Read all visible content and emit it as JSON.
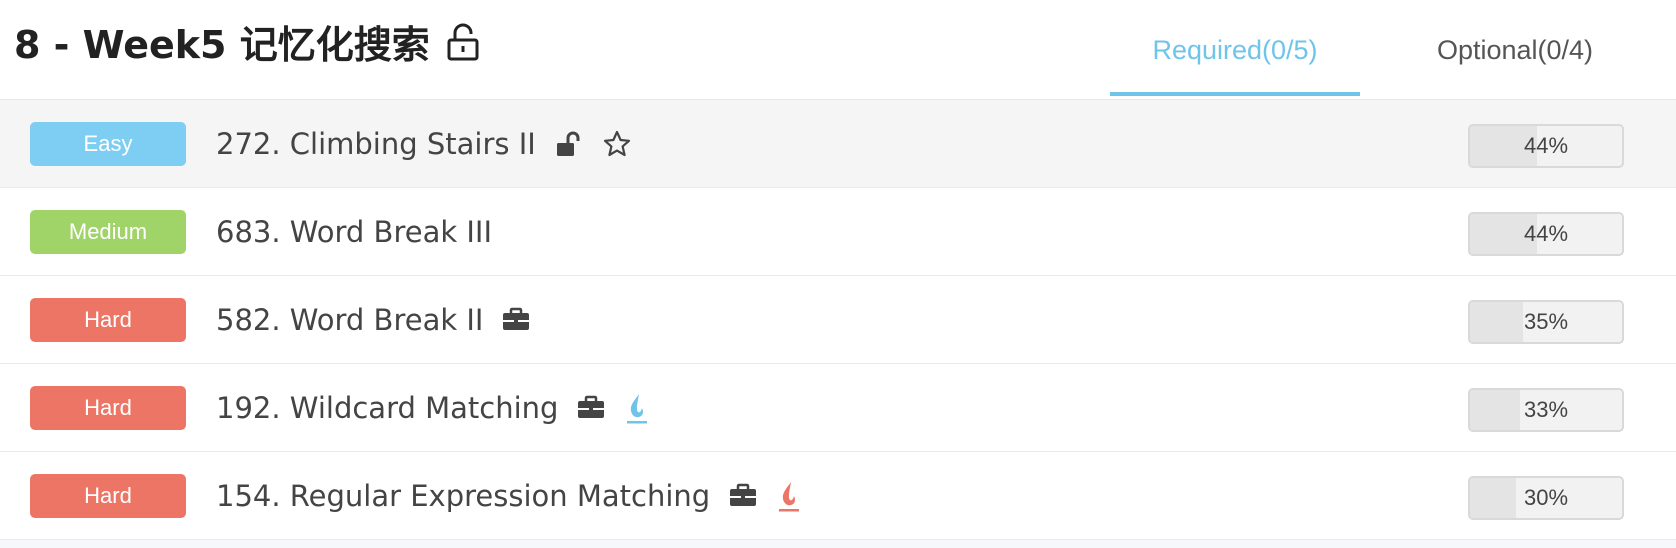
{
  "header": {
    "title": "8 - Week5 记忆化搜索",
    "title_icon": "unlocked-lock-icon",
    "tabs": [
      {
        "label": "Required(0/5)",
        "active": true
      },
      {
        "label": "Optional(0/4)",
        "active": false
      }
    ]
  },
  "colors": {
    "accent": "#6fc4ea",
    "easy": "#7ecef4",
    "medium": "#a0d468",
    "hard": "#ed7565"
  },
  "problems": [
    {
      "difficulty": "Easy",
      "title": "272. Climbing Stairs II",
      "icons": [
        "unlock-icon",
        "star-icon"
      ],
      "progress": "44%",
      "progress_value": 0.44
    },
    {
      "difficulty": "Medium",
      "title": "683. Word Break III",
      "icons": [],
      "progress": "44%",
      "progress_value": 0.44
    },
    {
      "difficulty": "Hard",
      "title": "582. Word Break II",
      "icons": [
        "briefcase-icon"
      ],
      "progress": "35%",
      "progress_value": 0.35
    },
    {
      "difficulty": "Hard",
      "title": "192. Wildcard Matching",
      "icons": [
        "briefcase-icon",
        "blue-flame-icon"
      ],
      "progress": "33%",
      "progress_value": 0.33
    },
    {
      "difficulty": "Hard",
      "title": "154. Regular Expression Matching",
      "icons": [
        "briefcase-icon",
        "red-flame-icon"
      ],
      "progress": "30%",
      "progress_value": 0.3
    }
  ]
}
